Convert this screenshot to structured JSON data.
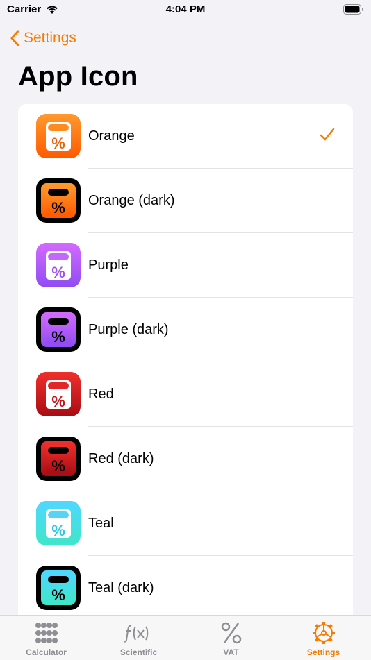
{
  "status_bar": {
    "carrier": "Carrier",
    "time": "4:04 PM"
  },
  "nav": {
    "back_label": "Settings"
  },
  "page": {
    "title": "App Icon"
  },
  "selected_index": 0,
  "accent_color": "#f57c00",
  "icons": [
    {
      "label": "Orange",
      "theme": "orange",
      "dark": false,
      "selected": true
    },
    {
      "label": "Orange (dark)",
      "theme": "orange",
      "dark": true,
      "selected": false
    },
    {
      "label": "Purple",
      "theme": "purple",
      "dark": false,
      "selected": false
    },
    {
      "label": "Purple (dark)",
      "theme": "purple",
      "dark": true,
      "selected": false
    },
    {
      "label": "Red",
      "theme": "red",
      "dark": false,
      "selected": false
    },
    {
      "label": "Red (dark)",
      "theme": "red",
      "dark": true,
      "selected": false
    },
    {
      "label": "Teal",
      "theme": "teal",
      "dark": false,
      "selected": false
    },
    {
      "label": "Teal (dark)",
      "theme": "teal",
      "dark": true,
      "selected": false
    }
  ],
  "tabs": [
    {
      "label": "Calculator",
      "icon": "keypad-grid-icon",
      "active": false
    },
    {
      "label": "Scientific",
      "icon": "function-icon",
      "active": false
    },
    {
      "label": "VAT",
      "icon": "percent-icon",
      "active": false
    },
    {
      "label": "Settings",
      "icon": "gear-icon",
      "active": true
    }
  ]
}
